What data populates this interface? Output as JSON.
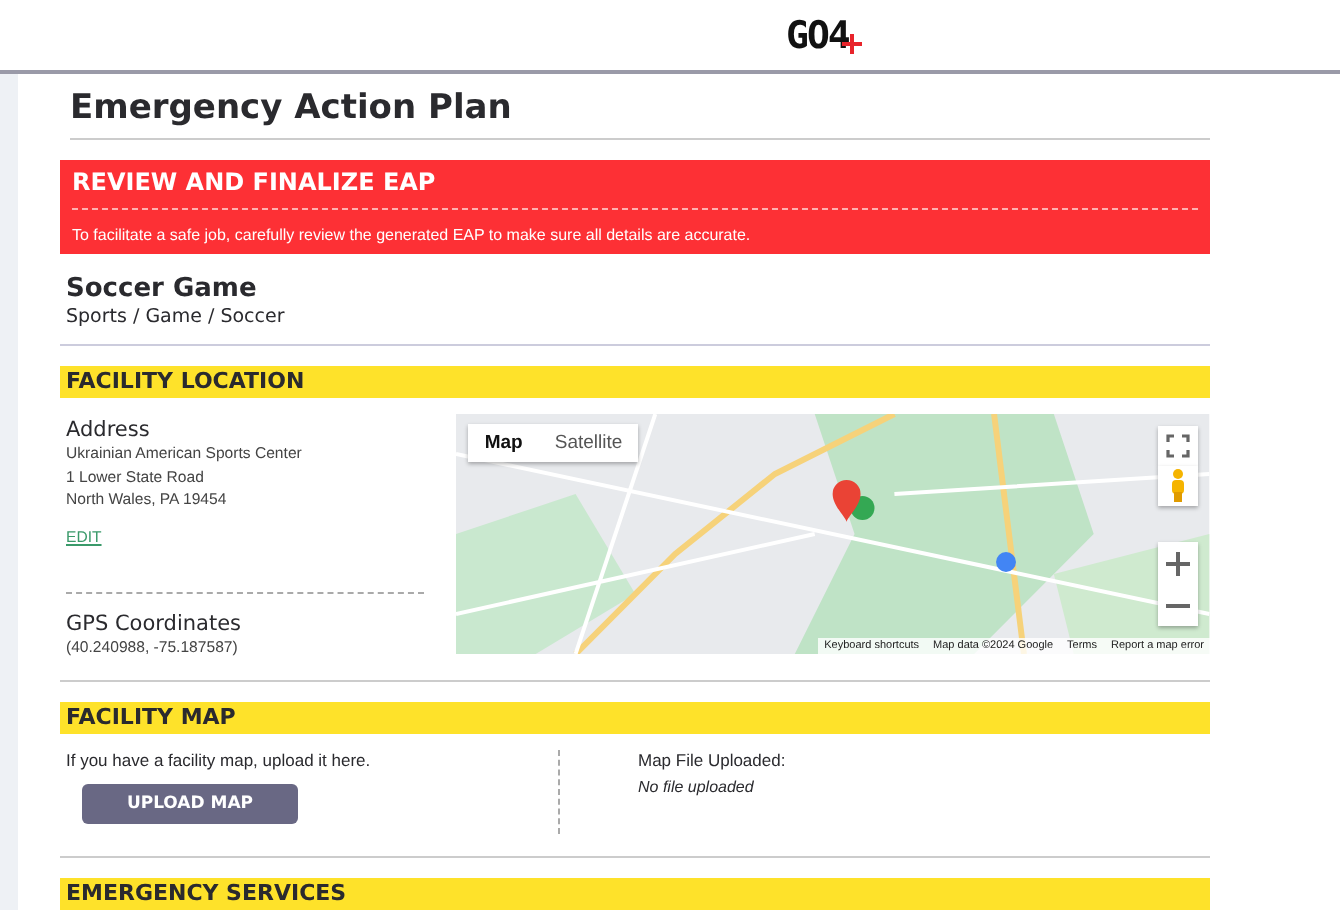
{
  "header": {
    "logo": "GO4"
  },
  "page": {
    "title": "Emergency Action Plan"
  },
  "alert": {
    "title": "REVIEW AND FINALIZE EAP",
    "message": "To facilitate a safe job, carefully review the generated EAP to make sure all details are accurate."
  },
  "event": {
    "name": "Soccer Game",
    "category": "Sports / Game / Soccer"
  },
  "facility_location": {
    "heading": "FACILITY LOCATION",
    "address_label": "Address",
    "address_lines": [
      "Ukrainian American Sports Center",
      "1 Lower State Road",
      "North Wales, PA 19454"
    ],
    "edit_link": "EDIT",
    "gps_label": "GPS Coordinates",
    "gps_value": "(40.240988, -75.187587)",
    "map": {
      "kind": "picture",
      "tabs": [
        {
          "label": "Map",
          "selected": true
        },
        {
          "label": "Satellite",
          "selected": false
        }
      ],
      "footer_links": [
        "Keyboard shortcuts",
        "Map data ©2024 Google",
        "Terms",
        "Report a map error"
      ]
    }
  },
  "facility_map": {
    "heading": "FACILITY MAP",
    "hint": "If you have a facility map, upload it here.",
    "button": "UPLOAD MAP",
    "uploaded_label": "Map File Uploaded:",
    "uploaded_value": "No file uploaded"
  },
  "emergency_services": {
    "heading": "EMERGENCY SERVICES"
  }
}
